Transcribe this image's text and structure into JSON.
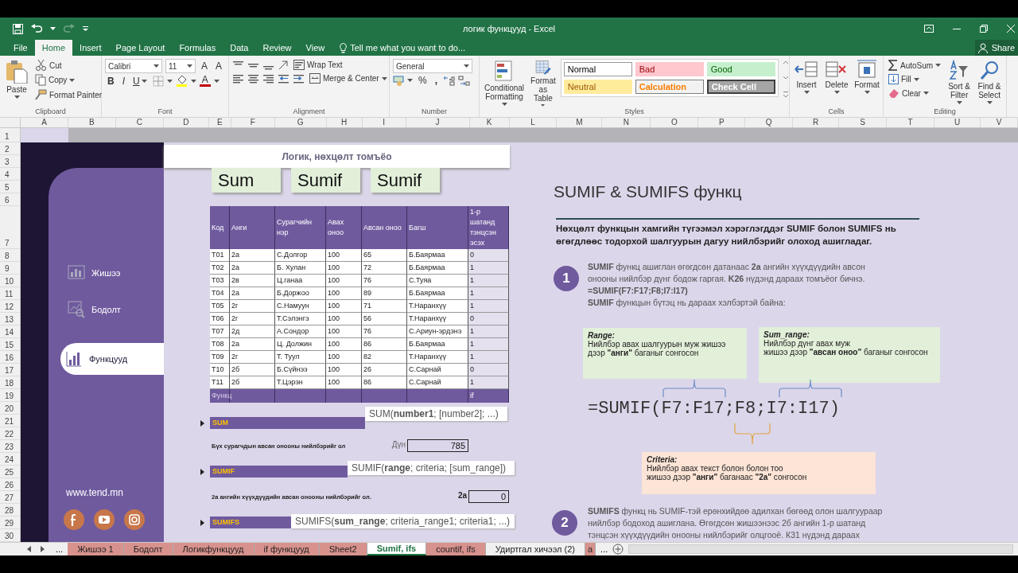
{
  "window": {
    "title": "логик функцууд - Excel",
    "share": "Share"
  },
  "menu_tabs": [
    {
      "label": "File",
      "selected": false
    },
    {
      "label": "Home",
      "selected": true
    },
    {
      "label": "Insert",
      "selected": false
    },
    {
      "label": "Page Layout",
      "selected": false
    },
    {
      "label": "Formulas",
      "selected": false
    },
    {
      "label": "Data",
      "selected": false
    },
    {
      "label": "Review",
      "selected": false
    },
    {
      "label": "View",
      "selected": false
    }
  ],
  "tell_me": {
    "placeholder": "Tell me what you want to do..."
  },
  "ribbon": {
    "clipboard": {
      "label": "Clipboard",
      "paste": "Paste",
      "cut": "Cut",
      "copy": "Copy",
      "format_painter": "Format Painter"
    },
    "font": {
      "label": "Font",
      "font_name": "Calibri",
      "font_size": "11",
      "grow": "A",
      "shrink": "A",
      "bold": "B",
      "italic": "I",
      "underline": "U",
      "font_color": "A"
    },
    "alignment": {
      "label": "Alignment",
      "wrap_text": "Wrap Text",
      "merge_center": "Merge & Center"
    },
    "number": {
      "label": "Number",
      "format": "General",
      "percent": "%",
      "comma": ","
    },
    "styles": {
      "label": "Styles",
      "conditional_formatting": "Conditional Formatting",
      "format_as_table": "Format as Table",
      "cell_styles": [
        {
          "label": "Normal",
          "kind": "normal"
        },
        {
          "label": "Bad",
          "kind": "bad"
        },
        {
          "label": "Good",
          "kind": "good"
        },
        {
          "label": "Neutral",
          "kind": "neutral"
        },
        {
          "label": "Calculation",
          "kind": "calculation"
        },
        {
          "label": "Check Cell",
          "kind": "check"
        }
      ]
    },
    "cells": {
      "label": "Cells",
      "insert": "Insert",
      "delete": "Delete",
      "format": "Format"
    },
    "editing": {
      "label": "Editing",
      "autosum": "AutoSum",
      "fill": "Fill",
      "clear": "Clear",
      "sort_filter": "Sort & Filter",
      "find_select": "Find & Select"
    }
  },
  "column_headers": [
    "A",
    "B",
    "C",
    "D",
    "E",
    "F",
    "G",
    "H",
    "I",
    "J",
    "K",
    "L",
    "M",
    "N",
    "O",
    "P",
    "Q",
    "R",
    "S",
    "T",
    "U",
    "V"
  ],
  "row_numbers": [
    "1",
    "2",
    "3",
    "4",
    "5",
    "6",
    "7",
    "8",
    "9",
    "10",
    "11",
    "12",
    "13",
    "14",
    "15",
    "16",
    "17",
    "18",
    "19",
    "20",
    "21",
    "22",
    "23",
    "24",
    "25",
    "26",
    "27",
    "28",
    "29",
    "30"
  ],
  "sheet": {
    "sidebar": {
      "items": [
        {
          "label": "Жишээ",
          "selected": false
        },
        {
          "label": "Бодолт",
          "selected": false
        },
        {
          "label": "Функцууд",
          "selected": true
        }
      ],
      "website": "www.tend.mn"
    },
    "banner": "Логик, нөхцөлт томъёо",
    "function_buttons": [
      "Sum",
      "Sumif",
      "Sumif"
    ],
    "table": {
      "columns": [
        "Код",
        "Анги",
        "Сурагчийн нэр",
        "Авах оноо",
        "Авсан оноо",
        "Багш",
        "1-р шатанд тэнцсэн эсэх"
      ],
      "rows": [
        [
          "Т01",
          "2а",
          "С.Долгор",
          "100",
          "65",
          "Б.Баярмаа",
          "0"
        ],
        [
          "Т02",
          "2а",
          "Б. Хулан",
          "100",
          "72",
          "Б.Баярмаа",
          "1"
        ],
        [
          "Т03",
          "2в",
          "Ц.ганаа",
          "100",
          "76",
          "С.Туяа",
          "1"
        ],
        [
          "Т04",
          "2а",
          "Б.Доржоо",
          "100",
          "89",
          "Б.Баярмаа",
          "1"
        ],
        [
          "Т05",
          "2г",
          "С.Намуун",
          "100",
          "71",
          "Т.Наранхүү",
          "1"
        ],
        [
          "Т06",
          "2г",
          "Т.Сэлэнгэ",
          "100",
          "56",
          "Т.Наранхүү",
          "0"
        ],
        [
          "Т07",
          "2д",
          "А.Сондор",
          "100",
          "76",
          "С.Ариун-эрдэнэ",
          "1"
        ],
        [
          "Т08",
          "2а",
          "Ц. Должин",
          "100",
          "86",
          "Б.Баярмаа",
          "1"
        ],
        [
          "Т09",
          "2г",
          "Т. Туул",
          "100",
          "82",
          "Т.Наранхүү",
          "1"
        ],
        [
          "Т10",
          "2б",
          "Б.Сүйнээ",
          "100",
          "26",
          "С.Сарнай",
          "0"
        ],
        [
          "Т11",
          "2б",
          "Т.Цэрэн",
          "100",
          "86",
          "С.Сарнай",
          "1"
        ]
      ],
      "footer": [
        "Функц",
        "if"
      ]
    },
    "sections": [
      {
        "title": "SUM",
        "tooltip": "SUM(**number1**; [number2]; ...)",
        "task": "Бүх сурагчдын авсан онооны нийлбэрийг ол",
        "answer_label": "Дүн",
        "answer": "785"
      },
      {
        "title": "SUMIF",
        "tooltip": "SUMIF(**range**; criteria; [sum_range])",
        "task": "2а ангийн хүүхдүүдийн авсан онооны нийлбэрийг ол.",
        "answer_label": "2а",
        "answer": "0"
      },
      {
        "title": "SUMIFS",
        "tooltip": "SUMIFS(**sum_range**; criteria_range1; criteria1; ...)"
      }
    ],
    "lesson": {
      "title": "SUMIF & SUMIFS функц",
      "intro": [
        "Нөхцөлт функцын хамгийн түгээмэл хэрэглэгддэг SUMIF болон SUMIFS нь",
        "өгөгдлөөс тодорхой шалгуурын дагуу нийлбэрийг олоход ашигладаг."
      ],
      "steps": [
        {
          "number": "1",
          "lines": [
            "**SUMIF** функц ашиглан өгөгдсөн датанаас **2а** ангийн хүүхдүүдийн авсон",
            "онооны нийлбэр дүнг бодож гаргая. **K26** нүдэнд дараах томъёог бичнэ.",
            "**=SUMIF(F7:F17;F8;I7:I17)**",
            "**SUMIF** функцын бүтэц нь дараах хэлбэртэй байна:"
          ]
        },
        {
          "number": "2",
          "lines": [
            "**SUMIFS** функц нь SUMIF-тэй ерөнхийдөө адилхан бөгөөд олон шалгуураар",
            "нийлбэр бодоход ашиглана. Өгөгдсөн жишээнээс 2б ангийн 1-р шатанд",
            "тэнцсэн хүүхдүүдийн онооны нийлбэрийг олцгооё. К31 нүдэнд дараах"
          ]
        }
      ],
      "formula": "=SUMIF(F7:F17;F8;I7:I17)",
      "notes": [
        {
          "kind": "range",
          "title": "Range:",
          "lines": [
            "Нийлбэр авах шалгуурын муж жишээ",
            "дээр **\"анги\"** баганыг сонгосон"
          ]
        },
        {
          "kind": "sum_range",
          "title": "Sum_range:",
          "lines": [
            "Нийлбэр дүнг авах муж",
            "жишээ дээр **\"авсан оноо\"** баганыг сонгосон"
          ]
        },
        {
          "kind": "criteria",
          "title": "Criteria:",
          "lines": [
            "Нийлбэр авах текст болон болон тоо",
            "жишээ дээр **\"анги\"** баганаас  **\"2а\"** сонгосон"
          ]
        }
      ]
    }
  },
  "sheet_tab_bar": {
    "more_left": "...",
    "more_right": "...",
    "tabs": [
      {
        "label": "Жишээ 1",
        "selected": false,
        "color": "#d8928d"
      },
      {
        "label": "Бодолт",
        "selected": false,
        "color": "#d8928d"
      },
      {
        "label": "Логикфункцууд",
        "selected": false,
        "color": "#d8928d"
      },
      {
        "label": "if  функцууд",
        "selected": false,
        "color": "#d8928d"
      },
      {
        "label": "Sheet2",
        "selected": false,
        "color": "#d8928d"
      },
      {
        "label": "Sumif, ifs",
        "selected": true
      },
      {
        "label": "countif, ifs",
        "selected": false,
        "color": "#d8928d"
      },
      {
        "label": "Удиртгал хичээл (2)",
        "selected": false
      },
      {
        "label": "a",
        "selected": false,
        "color": "#d8928d"
      }
    ]
  }
}
